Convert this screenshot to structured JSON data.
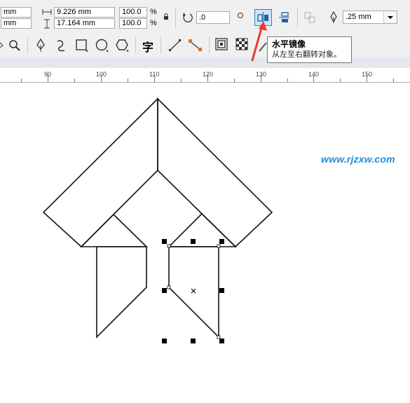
{
  "property_bar": {
    "unit_top": "mm",
    "unit_bottom": "mm",
    "width_value": "9.226 mm",
    "height_value": "17.164 mm",
    "scale_x": "100.0",
    "scale_y": "100.0",
    "percent_top": "%",
    "percent_bottom": "%",
    "rotation_value": ".0",
    "outline_width": ".25 mm"
  },
  "toolbar": {
    "text_tool_glyph": "字"
  },
  "tooltip": {
    "title": "水平镜像",
    "description": "从左至右翻转对象。"
  },
  "ruler": {
    "labels": [
      "90",
      "100",
      "110",
      "120",
      "130",
      "140",
      "150"
    ]
  },
  "canvas": {
    "watermark": "www.rjzxw.com"
  },
  "colors": {
    "highlight_border": "#3c7fb1",
    "highlight_fill": "#cce4f7",
    "annotation_arrow": "#e83a34",
    "watermark": "#1e8fe0"
  }
}
